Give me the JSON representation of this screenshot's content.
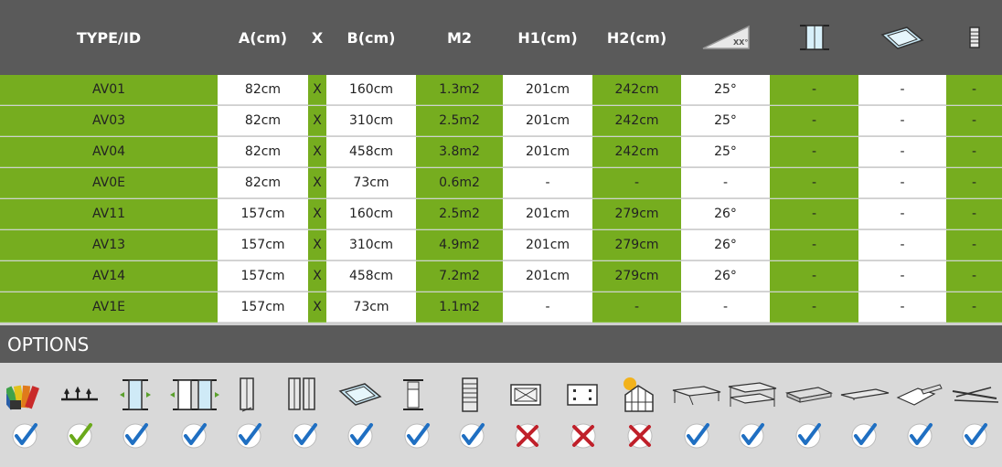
{
  "columns": [
    "TYPE/ID",
    "A(cm)",
    "X",
    "B(cm)",
    "M2",
    "H1(cm)",
    "H2(cm)"
  ],
  "header_icons": [
    "roof-angle-icon",
    "door-panel-icon",
    "roof-window-icon",
    "louvre-window-icon"
  ],
  "roof_angle_text": "XX°",
  "rows": [
    {
      "id": "AV01",
      "a": "82cm",
      "x": "X",
      "b": "160cm",
      "m2": "1.3m2",
      "h1": "201cm",
      "h2": "242cm",
      "angle": "25°",
      "c1": "-",
      "c2": "-",
      "c3": "-"
    },
    {
      "id": "AV03",
      "a": "82cm",
      "x": "X",
      "b": "310cm",
      "m2": "2.5m2",
      "h1": "201cm",
      "h2": "242cm",
      "angle": "25°",
      "c1": "-",
      "c2": "-",
      "c3": "-"
    },
    {
      "id": "AV04",
      "a": "82cm",
      "x": "X",
      "b": "458cm",
      "m2": "3.8m2",
      "h1": "201cm",
      "h2": "242cm",
      "angle": "25°",
      "c1": "-",
      "c2": "-",
      "c3": "-"
    },
    {
      "id": "AV0E",
      "a": "82cm",
      "x": "X",
      "b": "73cm",
      "m2": "0.6m2",
      "h1": "-",
      "h2": "-",
      "angle": "-",
      "c1": "-",
      "c2": "-",
      "c3": "-"
    },
    {
      "id": "AV11",
      "a": "157cm",
      "x": "X",
      "b": "160cm",
      "m2": "2.5m2",
      "h1": "201cm",
      "h2": "279cm",
      "angle": "26°",
      "c1": "-",
      "c2": "-",
      "c3": "-"
    },
    {
      "id": "AV13",
      "a": "157cm",
      "x": "X",
      "b": "310cm",
      "m2": "4.9m2",
      "h1": "201cm",
      "h2": "279cm",
      "angle": "26°",
      "c1": "-",
      "c2": "-",
      "c3": "-"
    },
    {
      "id": "AV14",
      "a": "157cm",
      "x": "X",
      "b": "458cm",
      "m2": "7.2m2",
      "h1": "201cm",
      "h2": "279cm",
      "angle": "26°",
      "c1": "-",
      "c2": "-",
      "c3": "-"
    },
    {
      "id": "AV1E",
      "a": "157cm",
      "x": "X",
      "b": "73cm",
      "m2": "1.1m2",
      "h1": "-",
      "h2": "-",
      "angle": "-",
      "c1": "-",
      "c2": "-",
      "c3": "-"
    }
  ],
  "options_title": "OPTIONS",
  "options": [
    {
      "icon": "colour-swatch-icon",
      "status": "check-blue"
    },
    {
      "icon": "roof-crest-icon",
      "status": "check-green"
    },
    {
      "icon": "single-door-icon",
      "status": "check-blue"
    },
    {
      "icon": "double-door-icon",
      "status": "check-blue"
    },
    {
      "icon": "hinged-door-icon",
      "status": "check-blue"
    },
    {
      "icon": "double-hinged-door-icon",
      "status": "check-blue"
    },
    {
      "icon": "roof-vent-icon",
      "status": "check-blue"
    },
    {
      "icon": "louvre-vent-icon",
      "status": "check-blue"
    },
    {
      "icon": "side-louvre-icon",
      "status": "check-blue"
    },
    {
      "icon": "base-frame-icon",
      "status": "cross"
    },
    {
      "icon": "foundation-anchor-icon",
      "status": "cross"
    },
    {
      "icon": "sun-greenhouse-icon",
      "status": "cross"
    },
    {
      "icon": "shelf-icon",
      "status": "check-blue"
    },
    {
      "icon": "staging-icon",
      "status": "check-blue"
    },
    {
      "icon": "grow-tray-icon",
      "status": "check-blue"
    },
    {
      "icon": "flat-shelf-icon",
      "status": "check-blue"
    },
    {
      "icon": "gutter-bracket-icon",
      "status": "check-blue"
    },
    {
      "icon": "water-butt-kit-icon",
      "status": "check-blue"
    }
  ],
  "colors": {
    "header": "#5a5a5a",
    "green": "#76ad1f",
    "check_blue": "#1f6fc2",
    "check_green": "#6aa91a",
    "cross": "#c0202a"
  }
}
